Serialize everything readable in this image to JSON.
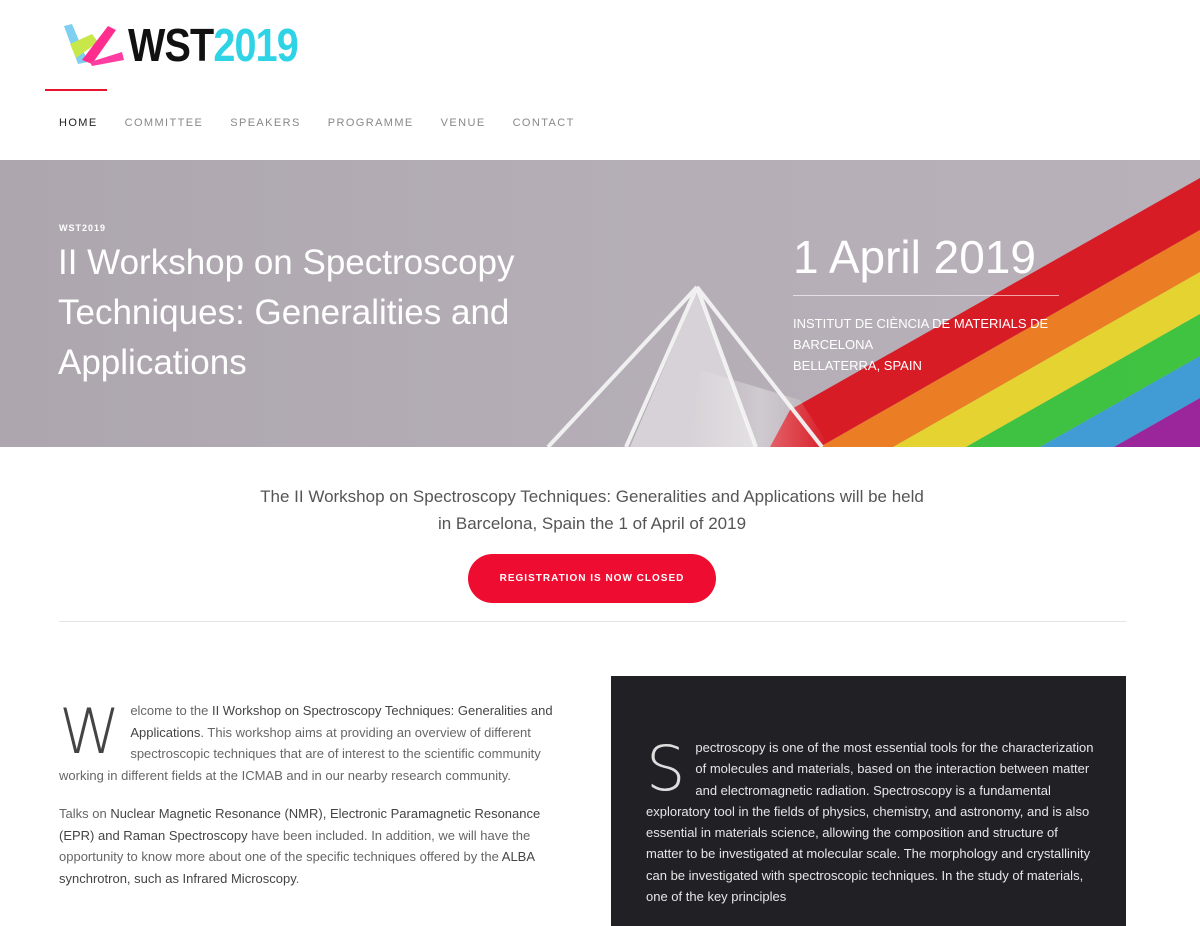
{
  "brand": {
    "logo_wst": "WST",
    "logo_year": "2019",
    "accent": "#e8142e",
    "year_color": "#2ed3e6"
  },
  "nav": {
    "items": [
      {
        "label": "HOME",
        "active": true
      },
      {
        "label": "COMMITTEE",
        "active": false
      },
      {
        "label": "SPEAKERS",
        "active": false
      },
      {
        "label": "PROGRAMME",
        "active": false
      },
      {
        "label": "VENUE",
        "active": false
      },
      {
        "label": "CONTACT",
        "active": false
      }
    ]
  },
  "hero": {
    "kicker": "WST2019",
    "title": "II Workshop on Spectroscopy Techniques: Generalities and Applications",
    "date": "1 April 2019",
    "location_line1": "INSTITUT DE CIÈNCIA DE MATERIALS DE BARCELONA",
    "location_line2": "BELLATERRA, SPAIN"
  },
  "intro": {
    "text": "The II Workshop on Spectroscopy Techniques: Generalities and Applications will be held in Barcelona, Spain the 1 of April of 2019",
    "button_label": "REGISTRATION IS NOW CLOSED",
    "button_color": "#ee0d30"
  },
  "welcome": {
    "dropcap": "W",
    "p1_a": "elcome to the ",
    "p1_strong": "II Workshop on Spectroscopy Techniques: Generalities and Applications",
    "p1_b": ". This workshop aims at providing an overview of different spectroscopic techniques that are of interest to the scientific community working in different fields at the ICMAB and in our nearby research community.",
    "p2_a": "Talks on ",
    "p2_s1": "Nuclear Magnetic Resonance (NMR), Electronic Paramagnetic Resonance (EPR) and Raman Spectroscopy",
    "p2_b": " have been included. In addition, we will have the opportunity to know more about one of the specific techniques offered by the ",
    "p2_s2": "ALBA synchrotron, such as Infrared Microscopy",
    "p2_c": "."
  },
  "spectroscopy": {
    "dropcap": "S",
    "text": "pectroscopy is one of the most essential tools for the characterization of molecules and materials, based on the interaction between matter and electromagnetic radiation. Spectroscopy is a fundamental exploratory tool in the fields of physics, chemistry, and astronomy, and is also essential in materials science, allowing the composition and structure of matter to be investigated at molecular scale. The morphology and crystallinity can be investigated with spectroscopic techniques. In the study of materials, one of the key principles",
    "panel_color": "#202025"
  }
}
